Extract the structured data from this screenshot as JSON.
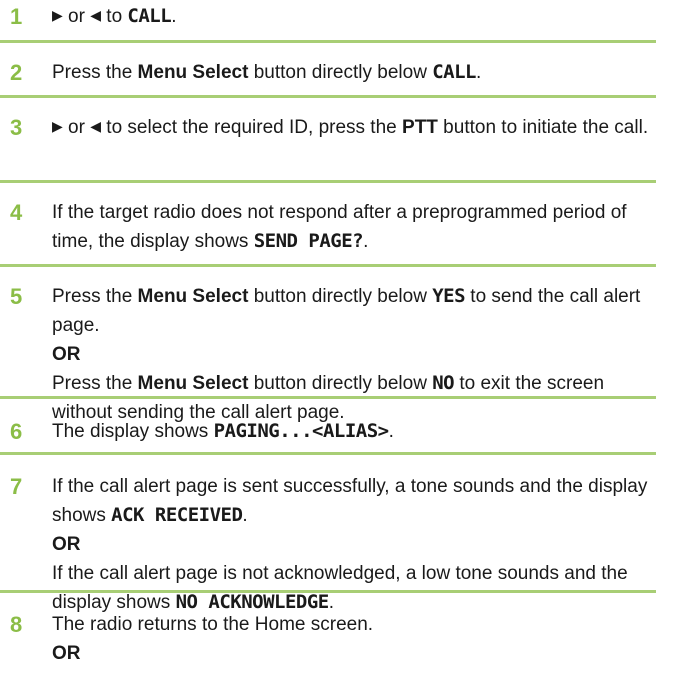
{
  "steps": [
    {
      "number": "1",
      "parts": [
        {
          "t": "arrow",
          "v": "▶"
        },
        {
          "t": "plain",
          "v": " or "
        },
        {
          "t": "arrow",
          "v": "◀"
        },
        {
          "t": "plain",
          "v": " to "
        },
        {
          "t": "lcd",
          "v": "CALL"
        },
        {
          "t": "plain",
          "v": "."
        }
      ]
    },
    {
      "number": "2",
      "parts": [
        {
          "t": "plain",
          "v": "Press the "
        },
        {
          "t": "bold",
          "v": "Menu Select"
        },
        {
          "t": "plain",
          "v": " button directly below "
        },
        {
          "t": "lcd",
          "v": "CALL"
        },
        {
          "t": "plain",
          "v": "."
        }
      ]
    },
    {
      "number": "3",
      "parts": [
        {
          "t": "arrow",
          "v": "▶"
        },
        {
          "t": "plain",
          "v": " or "
        },
        {
          "t": "arrow",
          "v": "◀"
        },
        {
          "t": "plain",
          "v": " to select the required ID, press the "
        },
        {
          "t": "bold",
          "v": "PTT"
        },
        {
          "t": "plain",
          "v": " button to initiate the call."
        }
      ]
    },
    {
      "number": "4",
      "parts": [
        {
          "t": "plain",
          "v": "If the target radio does not respond after a preprogrammed period of time, the display shows "
        },
        {
          "t": "lcd",
          "v": "SEND PAGE?"
        },
        {
          "t": "plain",
          "v": "."
        }
      ]
    },
    {
      "number": "5",
      "parts": [
        {
          "t": "plain",
          "v": "Press the "
        },
        {
          "t": "bold",
          "v": "Menu Select"
        },
        {
          "t": "plain",
          "v": " button directly below "
        },
        {
          "t": "lcd",
          "v": "YES"
        },
        {
          "t": "plain",
          "v": " to send the call alert page."
        },
        {
          "t": "or",
          "v": "OR"
        },
        {
          "t": "plain",
          "v": "Press the "
        },
        {
          "t": "bold",
          "v": "Menu Select"
        },
        {
          "t": "plain",
          "v": " button directly below "
        },
        {
          "t": "lcd",
          "v": "NO"
        },
        {
          "t": "plain",
          "v": " to exit the screen without sending the call alert page."
        }
      ]
    },
    {
      "number": "6",
      "parts": [
        {
          "t": "plain",
          "v": "The display shows "
        },
        {
          "t": "lcd",
          "v": "PAGING...<ALIAS>"
        },
        {
          "t": "plain",
          "v": "."
        }
      ]
    },
    {
      "number": "7",
      "parts": [
        {
          "t": "plain",
          "v": "If the call alert page is sent successfully, a tone sounds and the display shows "
        },
        {
          "t": "lcd",
          "v": "ACK RECEIVED"
        },
        {
          "t": "plain",
          "v": "."
        },
        {
          "t": "or",
          "v": "OR"
        },
        {
          "t": "plain",
          "v": "If the call alert page is not acknowledged, a low tone sounds and the display shows "
        },
        {
          "t": "lcd",
          "v": "NO ACKNOWLEDGE"
        },
        {
          "t": "plain",
          "v": "."
        }
      ]
    },
    {
      "number": "8",
      "parts": [
        {
          "t": "plain",
          "v": "The radio returns to the Home screen."
        },
        {
          "t": "or",
          "v": "OR"
        }
      ]
    }
  ]
}
